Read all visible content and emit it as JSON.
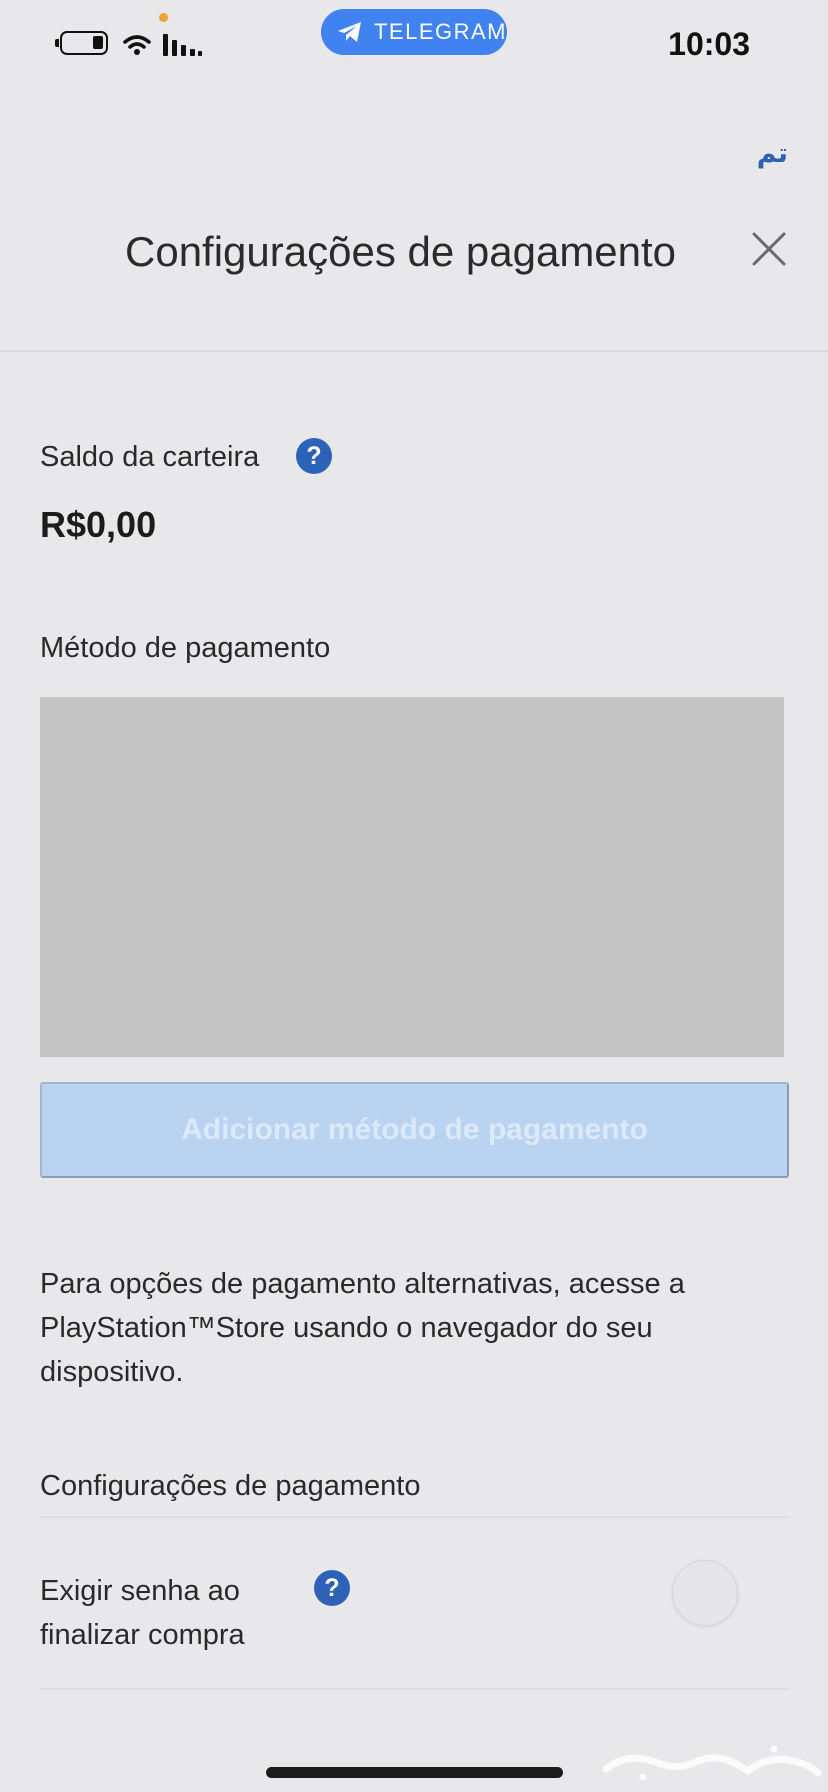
{
  "status_bar": {
    "time": "10:03",
    "notification_app": "TELEGRAM",
    "icons": [
      "battery-icon",
      "wifi-icon",
      "signal-icon",
      "telegram-icon"
    ],
    "accent": "#3f82f0"
  },
  "header": {
    "done_label": "تم",
    "title": "Configurações de pagamento",
    "close_icon": "close-icon"
  },
  "wallet": {
    "label": "Saldo da carteira",
    "help_glyph": "?",
    "balance": "R$0,00"
  },
  "payment_method": {
    "label": "Método de pagamento",
    "add_button_label": "Adicionar método de pagamento"
  },
  "alternative_info": "Para opções de pagamento alternativas, acesse a PlayStation™Store usando o navegador do seu dispositivo.",
  "settings": {
    "section_title": "Configurações de pagamento",
    "require_password_label": "Exigir senha ao finalizar compra",
    "help_glyph": "?",
    "require_password_enabled": false
  },
  "colors": {
    "link": "#2f5fb3",
    "help_badge": "#2e62b8",
    "disabled_button": "#b9d3f0",
    "background": "#e8e8ea"
  }
}
